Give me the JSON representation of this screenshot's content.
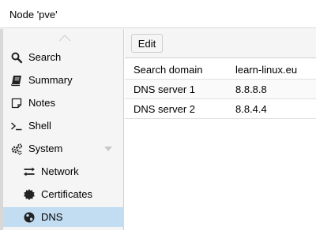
{
  "window": {
    "title": "Node 'pve'"
  },
  "sidebar": {
    "items": [
      {
        "label": "Search",
        "icon": "search-icon"
      },
      {
        "label": "Summary",
        "icon": "book-icon"
      },
      {
        "label": "Notes",
        "icon": "notes-icon"
      },
      {
        "label": "Shell",
        "icon": "terminal-icon"
      },
      {
        "label": "System",
        "icon": "cogs-icon"
      },
      {
        "label": "Network",
        "icon": "exchange-icon"
      },
      {
        "label": "Certificates",
        "icon": "certificate-icon"
      },
      {
        "label": "DNS",
        "icon": "globe-icon",
        "selected": true
      }
    ],
    "selected_color": "#c2ddf2"
  },
  "toolbar": {
    "edit_label": "Edit"
  },
  "dns": {
    "rows": [
      {
        "key": "Search domain",
        "value": "learn-linux.eu"
      },
      {
        "key": "DNS server 1",
        "value": "8.8.8.8"
      },
      {
        "key": "DNS server 2",
        "value": "8.8.4.4"
      }
    ]
  }
}
